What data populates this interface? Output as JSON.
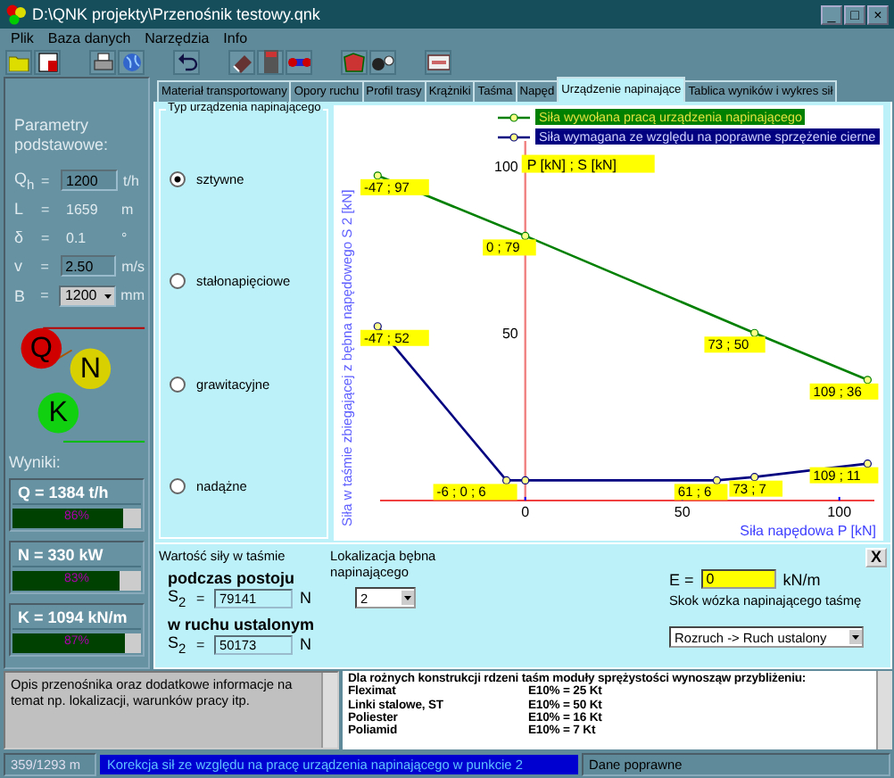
{
  "window": {
    "title": "D:\\QNK projekty\\Przenośnik testowy.qnk",
    "controls": [
      "_",
      "□",
      "×"
    ]
  },
  "menu": [
    "Plik",
    "Baza danych",
    "Narzędzia",
    "Info"
  ],
  "params": {
    "heading": "Parametry podstawowe:",
    "rows": [
      {
        "kind": "input",
        "symbol": "Q",
        "sub": "h",
        "sign": "=",
        "value": "1200",
        "unit": "t/h"
      },
      {
        "kind": "text",
        "symbol": "L",
        "sign": "=",
        "value": "1659",
        "unit": "m"
      },
      {
        "kind": "text",
        "symbol": "δ",
        "sign": "=",
        "value": "0.1",
        "unit": "°"
      },
      {
        "kind": "input",
        "symbol": "v",
        "sign": "=",
        "value": "2.50",
        "unit": "m/s"
      },
      {
        "kind": "select",
        "symbol": "B",
        "sign": "=",
        "value": "1200",
        "unit": "mm"
      }
    ]
  },
  "logo": [
    "Q",
    "N",
    "K"
  ],
  "results": {
    "heading": "Wyniki:",
    "items": [
      {
        "label": "Q = 1384 t/h",
        "reading": "86%",
        "level": 0.86
      },
      {
        "label": "N = 330 kW",
        "reading": "83%",
        "level": 0.83
      },
      {
        "label": "K = 1094 kN/m",
        "reading": "87%",
        "level": 0.87
      }
    ]
  },
  "tabs": [
    {
      "label": "Materiał transportowany",
      "selected": false
    },
    {
      "label": "Opory ruchu",
      "selected": false
    },
    {
      "label": "Profil trasy",
      "selected": false
    },
    {
      "label": "Krążniki",
      "selected": false
    },
    {
      "label": "Taśma",
      "selected": false
    },
    {
      "label": "Napęd",
      "selected": false
    },
    {
      "label": "Urządzenie napinające",
      "selected": true
    },
    {
      "label": "Tablica wyników i wykres sił",
      "selected": false
    }
  ],
  "device_type": {
    "title": "Typ urządzenia napinającego",
    "options": [
      {
        "label": "sztywne",
        "selected": true
      },
      {
        "label": "stałonapięciowe",
        "selected": false
      },
      {
        "label": "grawitacyjne",
        "selected": false
      },
      {
        "label": "nadążne",
        "selected": false
      }
    ]
  },
  "chart_data": {
    "type": "line",
    "xlabel": "Siła napędowa P [kN]",
    "ylabel": "Siła w taśmie zbiegającej z bębna napędowego S 2 [kN]",
    "xlim": [
      -61,
      114
    ],
    "ylim": [
      -12,
      118
    ],
    "xticks": [
      0,
      50,
      100
    ],
    "yticks": [
      50,
      100
    ],
    "legend": "top",
    "series": [
      {
        "name": "Siła wywołana pracą urządzenia napinającego",
        "color": "#008000",
        "marker": "circle",
        "x": [
          -47,
          0,
          73,
          109
        ],
        "values": [
          97,
          79,
          50,
          36
        ]
      },
      {
        "name": "Siła wymagana ze względu na poprawne sprzężenie cierne",
        "color": "#000080",
        "marker": "circle",
        "x": [
          -47,
          -6,
          0,
          61,
          73,
          109
        ],
        "values": [
          52,
          6,
          6,
          6,
          7,
          11
        ]
      }
    ],
    "annotations": [
      "P [kN] ; S [kN]",
      {
        "x": -47,
        "y": 97,
        "text": "-47 ; 97"
      },
      {
        "x": 0,
        "y": 79,
        "text": "0 ; 79"
      },
      {
        "x": 73,
        "y": 50,
        "text": "73 ; 50"
      },
      {
        "x": 109,
        "y": 36,
        "text": "109 ; 36"
      },
      {
        "x": -47,
        "y": 52,
        "text": "-47 ; 52"
      },
      {
        "x": -6,
        "y": 6,
        "text": "-6 ; 0 ; 6"
      },
      {
        "x": 61,
        "y": 6,
        "text": "61 ; 6"
      },
      {
        "x": 73,
        "y": 7,
        "text": "73 ; 7"
      },
      {
        "x": 109,
        "y": 11,
        "text": "109 ; 11"
      }
    ]
  },
  "form": {
    "title": "Wartość siły w taśmie",
    "stop_label": "podczas postoju",
    "stop_symbol": "S",
    "stop_sub": "2",
    "stop_sign": "=",
    "stop_value": "79141",
    "stop_unit": "N",
    "run_label": "w ruchu ustalonym",
    "run_symbol": "S",
    "run_sub": "2",
    "run_sign": "=",
    "run_value": "50173",
    "run_unit": "N",
    "location_label": "Lokalizacja bębna napinającego",
    "location_value": "2",
    "e_label": "E =",
    "e_value": "0",
    "e_unit": "kN/m",
    "stroke_label": "Skok wózka napinającego taśmę",
    "mode_value": "Rozruch -> Ruch ustalony",
    "close": "X"
  },
  "description": "Opis przenośnika oraz dodatkowe informacje na temat np. lokalizacji, warunków pracy itp.",
  "info": {
    "heading": "Dla rożnych konstrukcji rdzeni taśm moduły sprężystości wynosząw przybliżeniu:",
    "rows": [
      {
        "name": "Fleximat",
        "value": "E10% = 25 Kt"
      },
      {
        "name": "Linki stalowe, ST",
        "value": "E10% = 50 Kt"
      },
      {
        "name": "Poliester",
        "value": "E10% = 16 Kt"
      },
      {
        "name": "Poliamid",
        "value": "E10% = 7 Kt"
      }
    ]
  },
  "status_bar": {
    "position": "359/1293 m",
    "message": "Korekcja sił ze względu na pracę urządzenia napinającego w punkcie 2",
    "state": "Dane poprawne"
  }
}
